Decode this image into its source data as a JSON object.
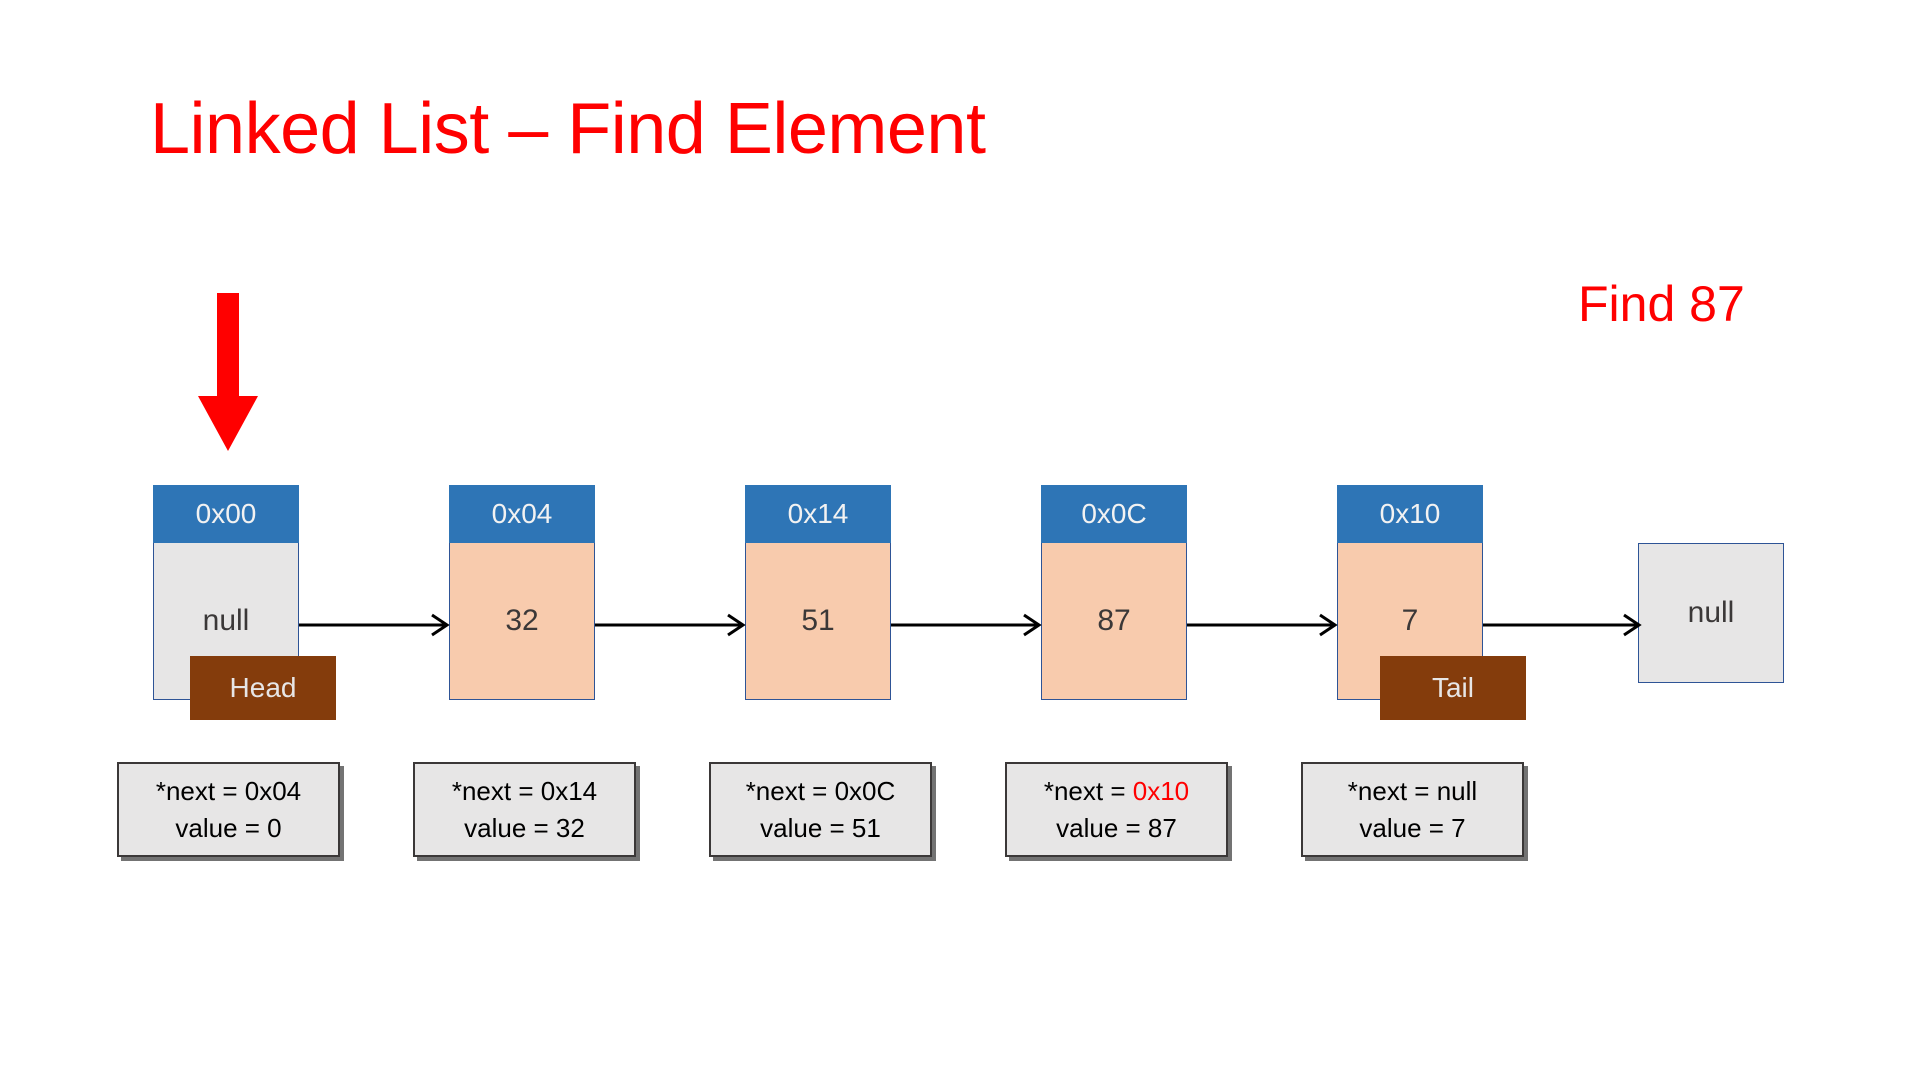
{
  "slide": {
    "title": "Linked List – Find Element",
    "title_color": "#FF0000",
    "find_label": "Find 87",
    "background": "#FFFFFF"
  },
  "colors": {
    "header_blue": "#2E75B6",
    "border_blue": "#2E5496",
    "body_peach": "#F8CBAD",
    "body_gray": "#E7E6E6",
    "badge_brown": "#843C0C",
    "highlight_red": "#FF0000",
    "text_dark": "#3B3838"
  },
  "pointer": {
    "icon": "down-arrow-icon",
    "color": "#FF0000",
    "points_at": "0x00"
  },
  "nodes": [
    {
      "address": "0x00",
      "value": "null",
      "fill": "gray",
      "badge": "Head"
    },
    {
      "address": "0x04",
      "value": "32",
      "fill": "peach",
      "badge": null
    },
    {
      "address": "0x14",
      "value": "51",
      "fill": "peach",
      "badge": null
    },
    {
      "address": "0x0C",
      "value": "87",
      "fill": "peach",
      "badge": null
    },
    {
      "address": "0x10",
      "value": "7",
      "fill": "peach",
      "badge": "Tail"
    }
  ],
  "terminal": {
    "value": "null"
  },
  "badges": {
    "head": "Head",
    "tail": "Tail"
  },
  "info_boxes": [
    {
      "next_label": "*next = ",
      "next_value": "0x04",
      "next_highlight": false,
      "value_line": "value = 0"
    },
    {
      "next_label": "*next = ",
      "next_value": "0x14",
      "next_highlight": false,
      "value_line": "value = 32"
    },
    {
      "next_label": "*next = ",
      "next_value": "0x0C",
      "next_highlight": false,
      "value_line": "value = 51"
    },
    {
      "next_label": "*next = ",
      "next_value": "0x10",
      "next_highlight": true,
      "value_line": "value = 87"
    },
    {
      "next_label": "*next = ",
      "next_value": "null",
      "next_highlight": false,
      "value_line": "value = 7"
    }
  ],
  "connectors": [
    {
      "from": "0x00",
      "to": "0x04"
    },
    {
      "from": "0x04",
      "to": "0x14"
    },
    {
      "from": "0x14",
      "to": "0x0C"
    },
    {
      "from": "0x0C",
      "to": "0x10"
    },
    {
      "from": "0x10",
      "to": "terminal"
    }
  ]
}
